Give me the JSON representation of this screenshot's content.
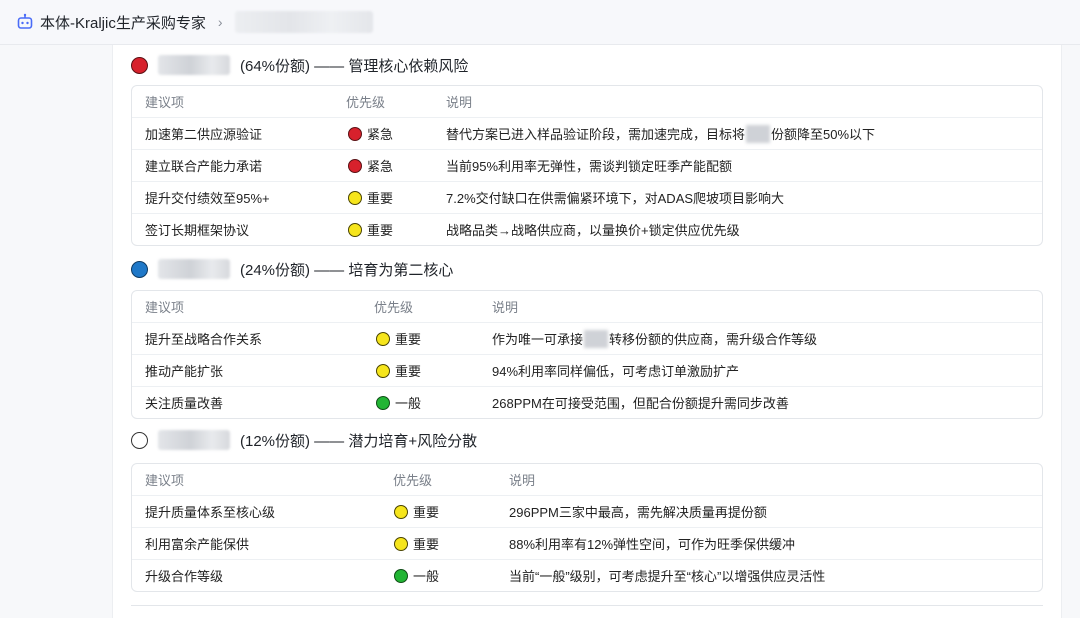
{
  "header": {
    "app_title": "本体-Kraljic生产采购专家",
    "separator": "›",
    "bot_icon": "robot-icon"
  },
  "sections": [
    {
      "color": "#d7212c",
      "heading": "(64%份额) —— 管理核心依赖风险",
      "columns": [
        "建议项",
        "优先级",
        "说明"
      ],
      "rows": [
        {
          "item": "加速第二供应源验证",
          "priority": "紧急",
          "priority_color": "red",
          "desc_before": "替代方案已进入样品验证阶段，需加速完成，目标将",
          "desc_after": "份额降至50%以下"
        },
        {
          "item": "建立联合产能力承诺",
          "priority": "紧急",
          "priority_color": "red",
          "desc": "当前95%利用率无弹性，需谈判锁定旺季产能配额"
        },
        {
          "item": "提升交付绩效至95%+",
          "priority": "重要",
          "priority_color": "yellow",
          "desc": "7.2%交付缺口在供需偏紧环境下，对ADAS爬坡项目影响大"
        },
        {
          "item": "签订长期框架协议",
          "priority": "重要",
          "priority_color": "yellow",
          "desc": "战略品类→战略供应商，以量换价+锁定供应优先级"
        }
      ]
    },
    {
      "color": "#1f78c8",
      "heading": "(24%份额) —— 培育为第二核心",
      "columns": [
        "建议项",
        "优先级",
        "说明"
      ],
      "rows": [
        {
          "item": "提升至战略合作关系",
          "priority": "重要",
          "priority_color": "yellow",
          "desc_before": "作为唯一可承接",
          "desc_after": "转移份额的供应商，需升级合作等级"
        },
        {
          "item": "推动产能扩张",
          "priority": "重要",
          "priority_color": "yellow",
          "desc": "94%利用率同样偏低，可考虑订单激励扩产"
        },
        {
          "item": "关注质量改善",
          "priority": "一般",
          "priority_color": "green",
          "desc": "268PPM在可接受范围，但配合份额提升需同步改善"
        }
      ]
    },
    {
      "color": "#ffffff",
      "heading": "(12%份额) —— 潜力培育+风险分散",
      "columns": [
        "建议项",
        "优先级",
        "说明"
      ],
      "rows": [
        {
          "item": "提升质量体系至核心级",
          "priority": "重要",
          "priority_color": "yellow",
          "desc": "296PPM三家中最高，需先解决质量再提份额"
        },
        {
          "item": "利用富余产能保供",
          "priority": "重要",
          "priority_color": "yellow",
          "desc": "88%利用率有12%弹性空间，可作为旺季保供缓冲"
        },
        {
          "item": "升级合作等级",
          "priority": "一般",
          "priority_color": "green",
          "desc": "当前“一般”级别，可考虑提升至“核心”以增强供应灵活性"
        }
      ]
    }
  ]
}
